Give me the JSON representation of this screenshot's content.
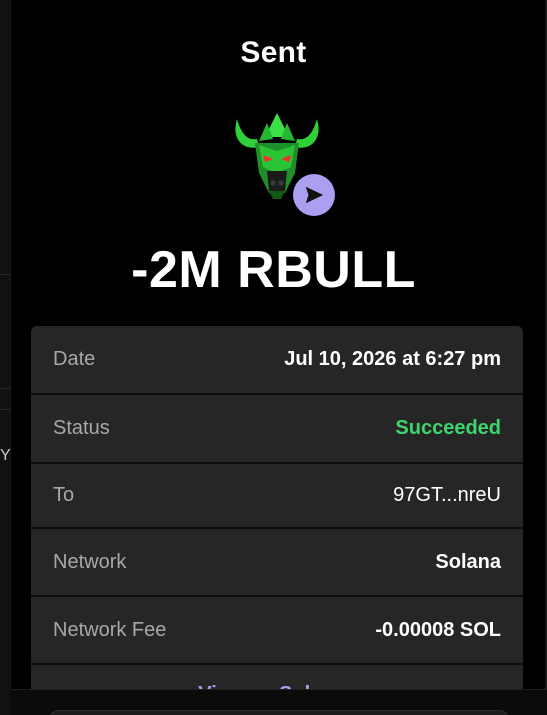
{
  "header": {
    "title": "Sent"
  },
  "token": {
    "logo_icon": "bull-token-logo",
    "badge_icon": "send-arrow-icon",
    "badge_color": "#ab9ff2"
  },
  "amount": {
    "text": "-2M RBULL"
  },
  "details": {
    "rows": [
      {
        "label": "Date",
        "value": "Jul 10, 2026 at 6:27 pm"
      },
      {
        "label": "Status",
        "value": "Succeeded"
      },
      {
        "label": "To",
        "value": "97GT...nreU"
      },
      {
        "label": "Network",
        "value": "Solana"
      },
      {
        "label": "Network Fee",
        "value": "-0.00008 SOL"
      }
    ],
    "link_label": "View on Solscan"
  },
  "background": {
    "left_glyph": "Y"
  },
  "colors": {
    "background": "#000000",
    "panel": "#262626",
    "success": "#3fd46d",
    "accent": "#ab9ff2"
  }
}
